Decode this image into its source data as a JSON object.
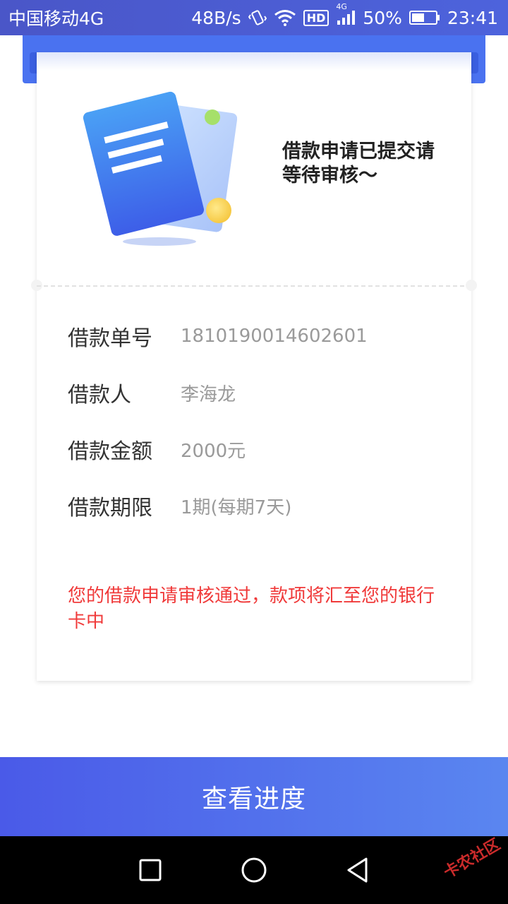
{
  "status_bar": {
    "carrier": "中国移动4G",
    "speed": "48B/s",
    "network_badge": "HD",
    "signal_label": "4G",
    "battery": "50%",
    "time": "23:41"
  },
  "card": {
    "headline": "借款申请已提交请等待审核～",
    "rows": [
      {
        "label": "借款单号",
        "value": "1810190014602601"
      },
      {
        "label": "借款人",
        "value": "李海龙"
      },
      {
        "label": "借款金额",
        "value": "2000元"
      },
      {
        "label": "借款期限",
        "value": "1期(每期7天)"
      }
    ],
    "notice": "您的借款申请审核通过，款项将汇至您的银行卡中"
  },
  "button": {
    "label": "查看进度"
  },
  "watermark": "卡农社区",
  "icons": [
    "vibrate-icon",
    "wifi-icon",
    "signal-icon",
    "battery-icon",
    "document-icon",
    "square-nav-icon",
    "circle-nav-icon",
    "triangle-back-icon"
  ],
  "colors": {
    "accent": "#4a5ae8",
    "notice": "#f03a3a"
  }
}
